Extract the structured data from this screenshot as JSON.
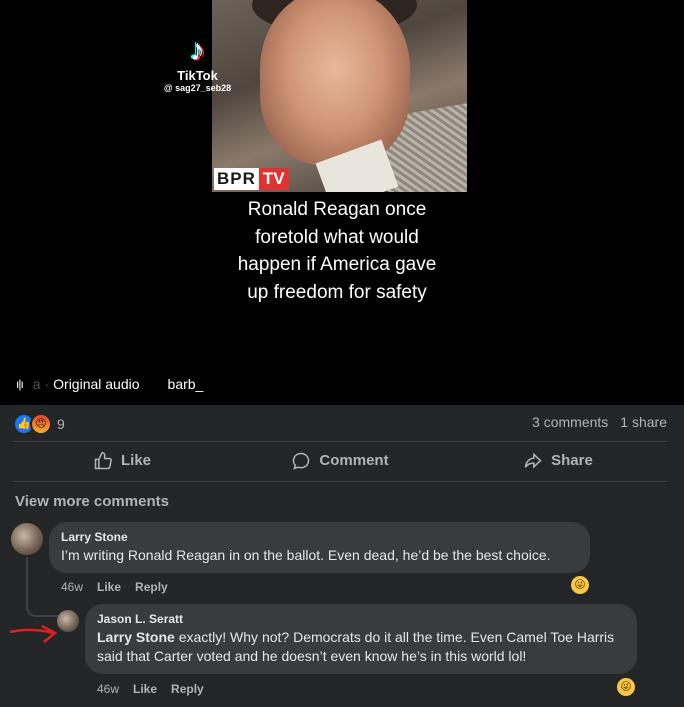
{
  "video": {
    "tiktok_logo": "♪",
    "tiktok_label": "TikTok",
    "tiktok_handle": "@ sag27_seb28",
    "watermark_bpr": "BPR",
    "watermark_tv": "TV",
    "caption": "Ronald Reagan once foretold what would happen if America gave up freedom for safety",
    "audio_prefix": "a ·",
    "audio_label": "Original audio",
    "audio_user": "barb_"
  },
  "post": {
    "reaction_count": "9",
    "comments_count": "3 comments",
    "shares_count": "1 share",
    "like_label": "Like",
    "comment_label": "Comment",
    "share_label": "Share",
    "view_more": "View more comments"
  },
  "comments": [
    {
      "author": "Larry Stone",
      "text": "I’m writing Ronald Reagan in on the ballot. Even dead, he’d be the best choice.",
      "time": "46w",
      "like": "Like",
      "reply": "Reply"
    },
    {
      "author": "Jason L. Seratt",
      "mention": "Larry Stone",
      "text": " exactly! Why not? Democrats do it all the time. Even Camel Toe Harris said that Carter voted and he doesn’t even know he’s in this world lol!",
      "time": "46w",
      "like": "Like",
      "reply": "Reply"
    }
  ],
  "colors": {
    "background": "#242526",
    "bubble": "#3a3b3c",
    "like_blue": "#1877f2",
    "annotation_red": "#e02020"
  }
}
